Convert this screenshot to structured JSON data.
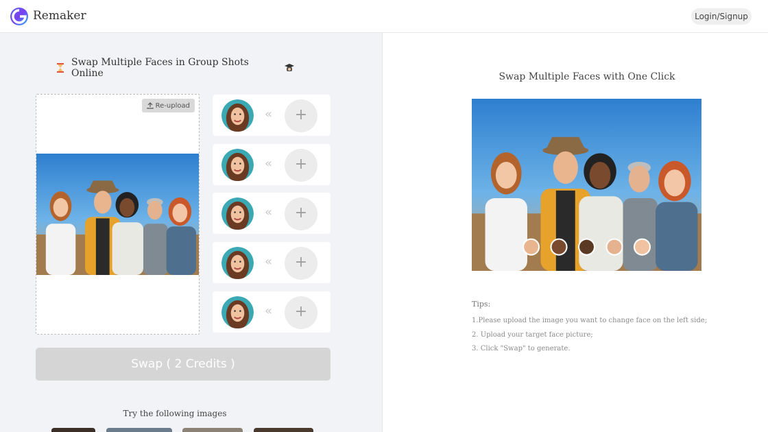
{
  "header": {
    "brand": "Remaker",
    "login_label": "Login/Signup"
  },
  "left_panel": {
    "title": "Swap Multiple Faces in Group Shots Online",
    "reupload_label": "Re-upload",
    "face_slots": [
      {
        "arrow": "«",
        "add": "+"
      },
      {
        "arrow": "«",
        "add": "+"
      },
      {
        "arrow": "«",
        "add": "+"
      },
      {
        "arrow": "«",
        "add": "+"
      },
      {
        "arrow": "«",
        "add": "+"
      }
    ],
    "swap_label": "Swap ( 2 Credits )",
    "try_label": "Try the following images"
  },
  "right_panel": {
    "title": "Swap Multiple Faces with One Click",
    "tips_heading": "Tips:",
    "tips": [
      "1.Please upload the image you want to change face on the left side;",
      "2. Upload your target face picture;",
      "3. Click \"Swap\" to generate."
    ]
  },
  "icons": {
    "logo": "remaker-logo-icon",
    "title_left": "hourglass-icon",
    "title_right": "graduation-cap-icon",
    "reupload": "upload-icon",
    "add": "plus-icon"
  },
  "colors": {
    "panel_bg": "#f2f3f6",
    "swap_disabled": "#d5d5d5",
    "accent_teal": "#3aa9b4"
  }
}
